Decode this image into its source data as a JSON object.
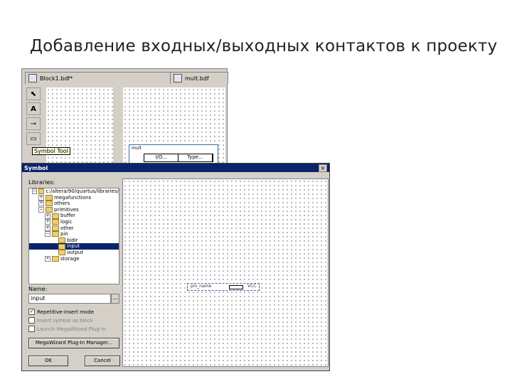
{
  "slide": {
    "title": "Добавление входных/выходных контактов к проекту"
  },
  "editor": {
    "tabs": [
      {
        "label": "Block1.bdf*"
      },
      {
        "label": "mult.bdf"
      }
    ],
    "tooltip": "Symbol Tool",
    "pin_table": {
      "name": "mult",
      "columns": [
        "I/O...",
        "Type..."
      ]
    },
    "tools": [
      "select-icon",
      "text-icon",
      "symbol-icon",
      "pin-icon"
    ]
  },
  "dialog": {
    "title": "Symbol",
    "close": "×",
    "libraries_label": "Libraries:",
    "tree": [
      {
        "label": "c:/altera/90/quartus/libraries/",
        "level": 0,
        "expander": "−"
      },
      {
        "label": "megafunctions",
        "level": 1,
        "expander": "+"
      },
      {
        "label": "others",
        "level": 1,
        "expander": "+"
      },
      {
        "label": "primitives",
        "level": 1,
        "expander": "−"
      },
      {
        "label": "buffer",
        "level": 2,
        "expander": "+"
      },
      {
        "label": "logic",
        "level": 2,
        "expander": "+"
      },
      {
        "label": "other",
        "level": 2,
        "expander": "+"
      },
      {
        "label": "pin",
        "level": 2,
        "expander": "−"
      },
      {
        "label": "bidir",
        "level": 3,
        "expander": ""
      },
      {
        "label": "input",
        "level": 3,
        "expander": "",
        "selected": true
      },
      {
        "label": "output",
        "level": 3,
        "expander": ""
      },
      {
        "label": "storage",
        "level": 2,
        "expander": "+"
      }
    ],
    "name_label": "Name:",
    "name_value": "input",
    "browse": "...",
    "options": [
      {
        "label": "Repetitive-insert mode",
        "checked": true,
        "disabled": false
      },
      {
        "label": "Insert symbol as block",
        "checked": false,
        "disabled": true
      },
      {
        "label": "Launch MegaWizard Plug-In",
        "checked": false,
        "disabled": true
      }
    ],
    "megawizard_button": "MegaWizard Plug-In Manager...",
    "ok_button": "OK",
    "cancel_button": "Cancel",
    "preview_symbol": {
      "name": "pin_name",
      "value": "VCC"
    }
  }
}
